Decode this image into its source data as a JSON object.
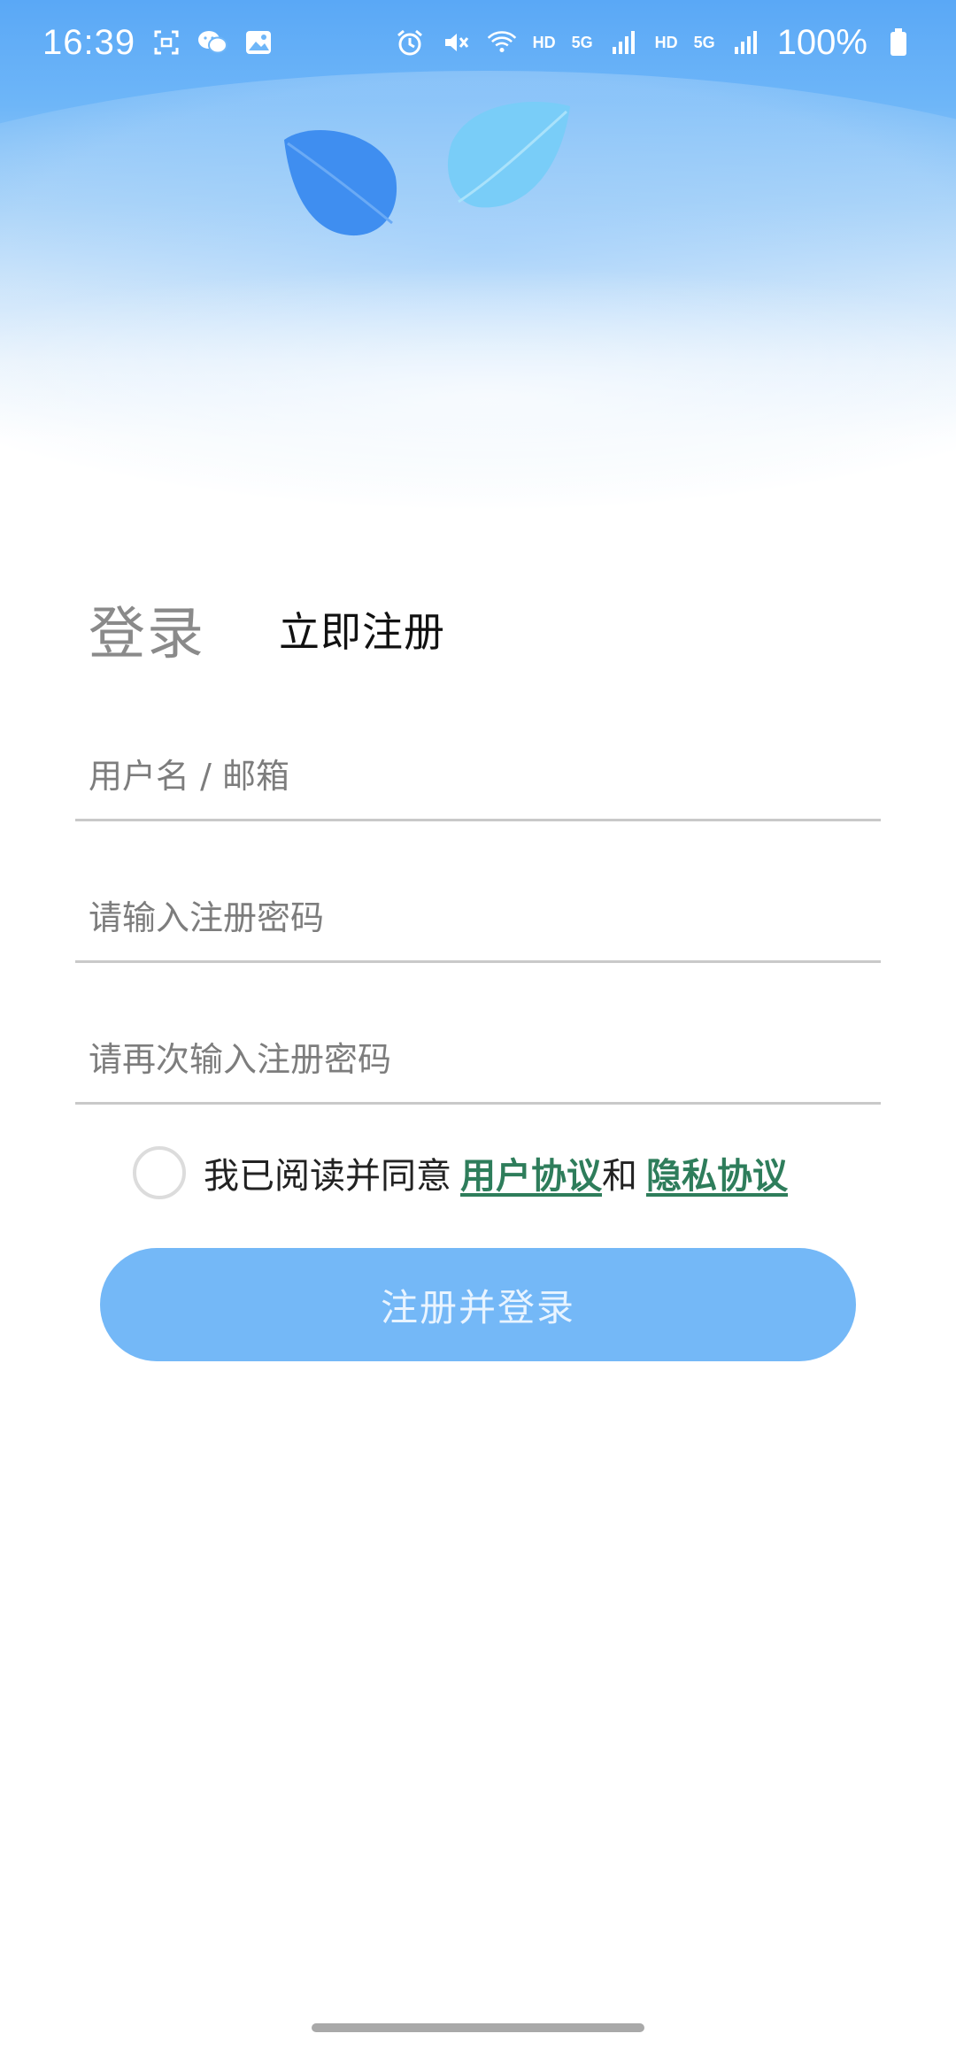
{
  "status_bar": {
    "time": "16:39",
    "left_icons": [
      "screenshot-icon",
      "wechat-icon",
      "gallery-icon"
    ],
    "right_icons": [
      "alarm-icon",
      "mute-icon",
      "wifi-icon",
      "signal-icon",
      "signal-icon"
    ],
    "hd_1": "HD",
    "net_1": "5G",
    "hd_2": "HD",
    "net_2": "5G",
    "battery": "100%"
  },
  "tabs": {
    "login": "登录",
    "register": "立即注册"
  },
  "form": {
    "username_placeholder": "用户名 / 邮箱",
    "password_placeholder": "请输入注册密码",
    "confirm_placeholder": "请再次输入注册密码"
  },
  "agreement": {
    "prefix": "我已阅读并同意",
    "user_agreement": "用户协议",
    "and": "和",
    "privacy_policy": "隐私协议"
  },
  "submit": {
    "label": "注册并登录"
  },
  "colors": {
    "primary": "#74b8f7",
    "link": "#2e7d5b",
    "header_top": "#5aa8f6"
  }
}
